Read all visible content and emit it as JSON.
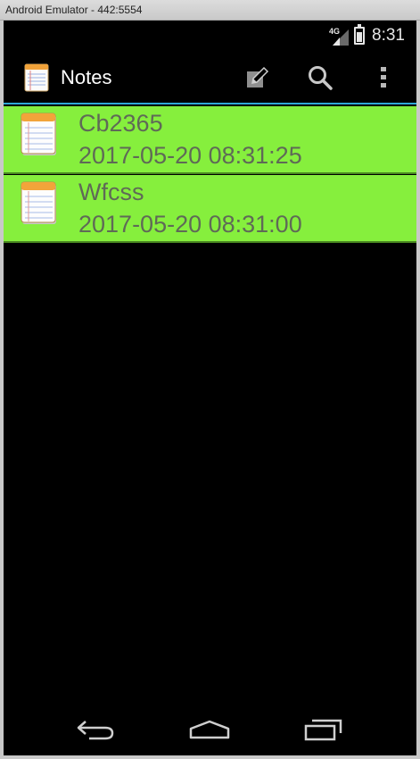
{
  "window": {
    "title": "Android Emulator - 442:5554"
  },
  "status_bar": {
    "network": "4G",
    "time": "8:31"
  },
  "action_bar": {
    "app_title": "Notes",
    "actions": [
      "compose-icon",
      "search-icon",
      "overflow-menu-icon"
    ]
  },
  "notes": [
    {
      "title": "Cb2365",
      "date": "2017-05-20 08:31:25"
    },
    {
      "title": "Wfcss",
      "date": "2017-05-20 08:31:00"
    }
  ],
  "nav_bar": {
    "buttons": [
      "back-icon",
      "home-icon",
      "recents-icon"
    ]
  },
  "colors": {
    "note_background": "#86ef3d",
    "note_text": "#5f6a57",
    "accent_line": "#2fa8d6",
    "screen_background": "#000000"
  }
}
